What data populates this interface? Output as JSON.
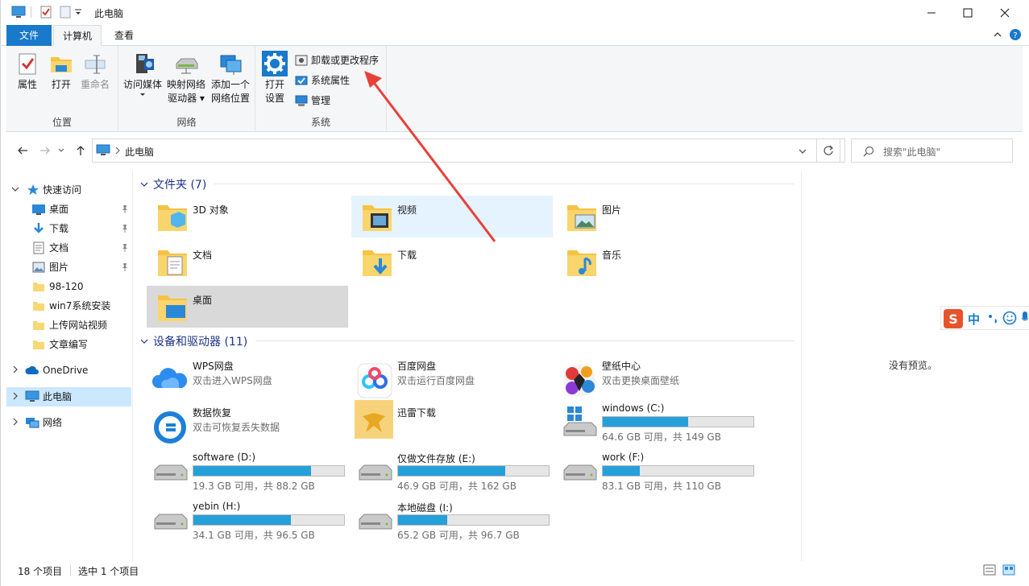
{
  "window": {
    "title": "此电脑",
    "min_icon": "minimize-icon",
    "max_icon": "maximize-icon",
    "close_icon": "close-icon"
  },
  "ribbon_tabs": {
    "file": "文件",
    "computer": "计算机",
    "view": "查看"
  },
  "ribbon": {
    "location": {
      "label": "位置",
      "properties": "属性",
      "open": "打开",
      "rename": "重命名"
    },
    "network": {
      "label": "网络",
      "access_media": "访问媒体",
      "map_drive_1": "映射网络",
      "map_drive_2": "驱动器",
      "add_location_1": "添加一个",
      "add_location_2": "网络位置"
    },
    "system": {
      "label": "系统",
      "open_settings_1": "打开",
      "open_settings_2": "设置",
      "uninstall": "卸载或更改程序",
      "sys_props": "系统属性",
      "manage": "管理"
    }
  },
  "address": {
    "path": "此电脑",
    "search_placeholder": "搜索\"此电脑\""
  },
  "sidenav": {
    "quick_access": "快速访问",
    "items": [
      {
        "label": "桌面",
        "pinned": true
      },
      {
        "label": "下载",
        "pinned": true
      },
      {
        "label": "文档",
        "pinned": true
      },
      {
        "label": "图片",
        "pinned": true
      },
      {
        "label": "98-120",
        "pinned": false
      },
      {
        "label": "win7系统安装",
        "pinned": false
      },
      {
        "label": "上传网站视频",
        "pinned": false
      },
      {
        "label": "文章编写",
        "pinned": false
      }
    ],
    "onedrive": "OneDrive",
    "this_pc": "此电脑",
    "network": "网络"
  },
  "folders": {
    "heading": "文件夹 (7)",
    "items": [
      "3D 对象",
      "视频",
      "图片",
      "文档",
      "下载",
      "音乐",
      "桌面"
    ]
  },
  "devices": {
    "heading": "设备和驱动器 (11)",
    "apps": [
      {
        "name": "WPS网盘",
        "sub": "双击进入WPS网盘"
      },
      {
        "name": "百度网盘",
        "sub": "双击运行百度网盘"
      },
      {
        "name": "壁纸中心",
        "sub": "双击更换桌面壁纸"
      },
      {
        "name": "数据恢复",
        "sub": "双击可恢复丢失数据"
      },
      {
        "name": "迅雷下载",
        "sub": ""
      }
    ],
    "drives": [
      {
        "name": "windows (C:)",
        "free": "64.6 GB 可用，共 149 GB",
        "used_fraction": 0.566
      },
      {
        "name": "software (D:)",
        "free": "19.3 GB 可用，共 88.2 GB",
        "used_fraction": 0.781
      },
      {
        "name": "仅做文件存放 (E:)",
        "free": "46.9 GB 可用，共 162 GB",
        "used_fraction": 0.71
      },
      {
        "name": "work (F:)",
        "free": "83.1 GB 可用，共 110 GB",
        "used_fraction": 0.245
      },
      {
        "name": "yebin (H:)",
        "free": "34.1 GB 可用，共 96.5 GB",
        "used_fraction": 0.647
      },
      {
        "name": "本地磁盘 (I:)",
        "free": "65.2 GB 可用，共 96.7 GB",
        "used_fraction": 0.326
      }
    ]
  },
  "preview": {
    "text": "没有预览。"
  },
  "status": {
    "count": "18 个项目",
    "selected": "选中 1 个项目"
  },
  "ime": {
    "char": "中"
  },
  "colors": {
    "accent": "#1979ca",
    "bar_fill": "#26a0da",
    "arrow": "#e8413a"
  }
}
